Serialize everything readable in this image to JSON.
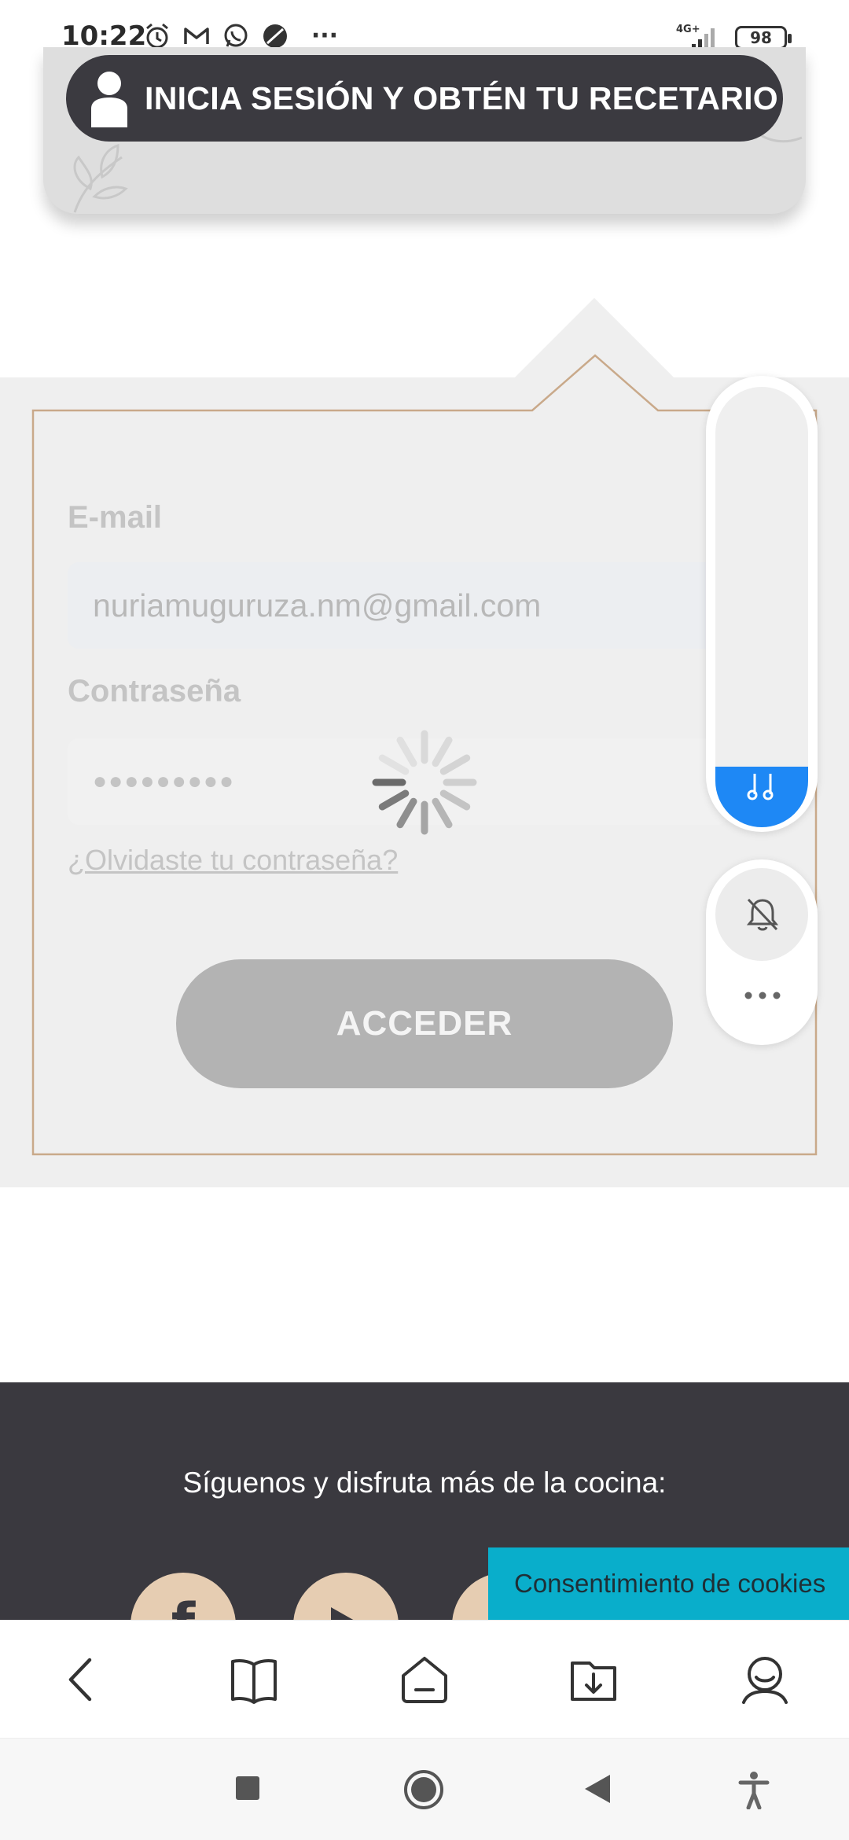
{
  "status_bar": {
    "time": "10:22",
    "icons": [
      "alarm-icon",
      "gmail-icon",
      "whatsapp-icon",
      "app-icon",
      "more-dots-icon",
      "signal-4g-icon"
    ],
    "network": "4G+",
    "battery": "98"
  },
  "banner": {
    "label": "INICIA SESIÓN Y OBTÉN TU RECETARIO"
  },
  "form": {
    "email_label": "E-mail",
    "email_value": "nuriamuguruza.nm@gmail.com",
    "password_label": "Contraseña",
    "password_value": "●●●●●●●●●",
    "forgot_link": "¿Olvidaste tu contraseña?",
    "submit_label": "ACCEDER",
    "loading": true
  },
  "floating_panel": {
    "music_icon": "music-note-icon",
    "bell_icon": "bell-off-icon",
    "more_icon": "more-dots-icon"
  },
  "footer": {
    "follow_text": "Síguenos y disfruta más de la cocina:",
    "social_icons": [
      "facebook-icon",
      "youtube-icon",
      "twitter-icon"
    ]
  },
  "cookie_banner": {
    "label": "Consentimiento de cookies"
  },
  "browser_nav": {
    "items": [
      "back-icon",
      "book-icon",
      "home-icon",
      "download-icon",
      "profile-icon"
    ]
  },
  "system_nav": {
    "items": [
      "recents-icon",
      "home-circle-icon",
      "back-triangle-icon",
      "accessibility-icon"
    ]
  },
  "colors": {
    "banner_dark": "#3b3a40",
    "form_border": "#c9a98a",
    "accent_blue": "#1e88f5",
    "cookie_cyan": "#09aecb",
    "footer_dark": "#3a393f",
    "social_tan": "#e6cdb2"
  }
}
